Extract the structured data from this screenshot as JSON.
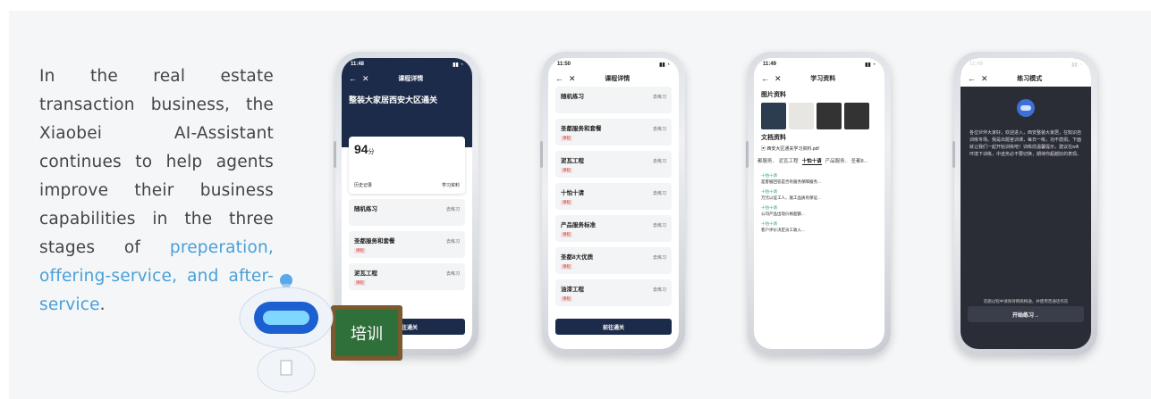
{
  "intro": {
    "part1": "In the real estate transaction business, the Xiaobei AI-Assistant continues to help agents improve their business capabilities in the three stages of ",
    "highlight": "preperation, offering-service, and after-service",
    "part2": "."
  },
  "mascot": {
    "board_text": "培训"
  },
  "phone1": {
    "time": "11:48",
    "nav_title": "课程详情",
    "header_title": "整装大家居西安大区通关",
    "score": "94",
    "score_unit": "分",
    "history": "历史记录",
    "materials": "学习资料",
    "items": [
      {
        "name": "随机练习",
        "go": "去练习"
      },
      {
        "name": "圣都服务和套餐",
        "tag": "课程",
        "go": "去练习"
      },
      {
        "name": "泥瓦工程",
        "tag": "课程",
        "go": "去练习"
      }
    ],
    "button": "前往通关"
  },
  "phone2": {
    "time": "11:50",
    "nav_title": "课程详情",
    "items": [
      {
        "name": "随机练习",
        "go": "去练习"
      },
      {
        "name": "圣都服务和套餐",
        "tag": "课程",
        "go": "去练习"
      },
      {
        "name": "泥瓦工程",
        "tag": "课程",
        "go": "去练习"
      },
      {
        "name": "十怕十请",
        "tag": "课程",
        "go": "去练习"
      },
      {
        "name": "产品服务标准",
        "tag": "课程",
        "go": "去练习"
      },
      {
        "name": "圣都8大优质",
        "tag": "课程",
        "go": "去练习"
      },
      {
        "name": "油漆工程",
        "tag": "课程",
        "go": "去练习"
      }
    ],
    "button": "前往通关"
  },
  "phone3": {
    "time": "11:49",
    "nav_title": "学习资料",
    "images_title": "图片资料",
    "docs_title": "文档资料",
    "doc_name": "西安大区通关学习资料.pdf",
    "tabs": [
      "都服务..",
      "泥瓦工程",
      "十怕十请",
      "产品服务..",
      "圣都8..."
    ],
    "active_tab": "十怕十请",
    "qa": [
      {
        "q": "十怕十请",
        "a": "是客服回答是否有服务保障服务..."
      },
      {
        "q": "十怕十请",
        "a": "万元以证工人，施工品质有保证..."
      },
      {
        "q": "十怕十请",
        "a": "公司产品出现价格超额..."
      },
      {
        "q": "十怕十请",
        "a": "客户评价决定员工收入..."
      }
    ]
  },
  "phone4": {
    "time": "11:49",
    "nav_title": "练习模式",
    "message": "各位伙伴大家好，欢迎进入，西安整装大家居，在知识自训练专场。我是出题官训课，每日一练，功不唐捐。下面就让我们一起开始训练吧！训练前温馨提示，建议在wifi环境下训练，中途务必不要切换，期待你超越好的表现。",
    "hint": "答题过程中请保持网络畅通，并使用普通话作答",
    "button": "开始练习→"
  }
}
